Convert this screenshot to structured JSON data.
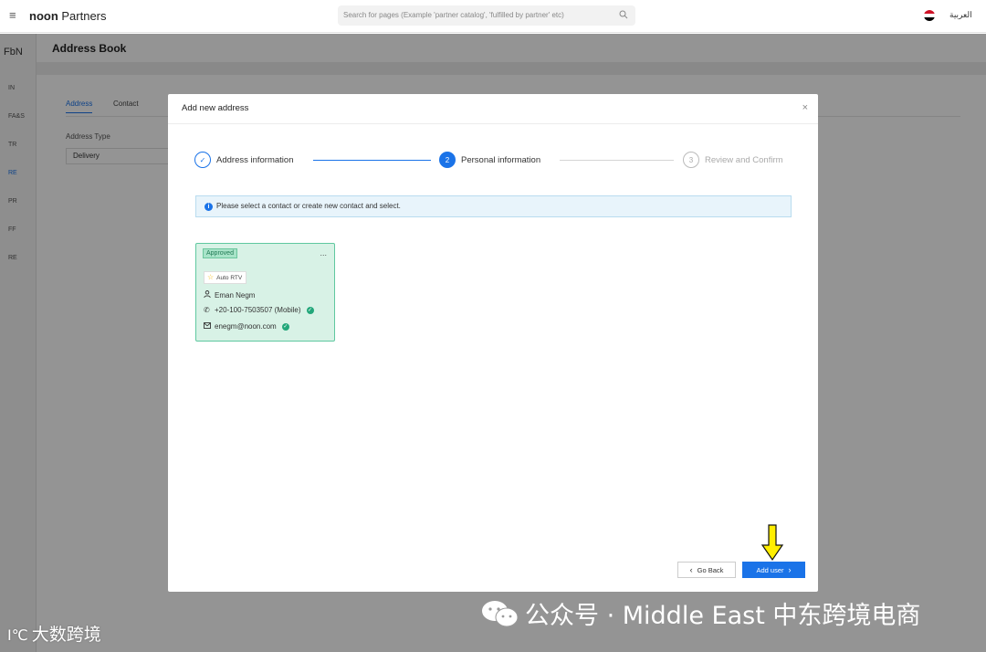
{
  "topbar": {
    "brand_bold": "noon",
    "brand_rest": " Partners",
    "search_placeholder": "Search for pages (Example 'partner catalog', 'fulfilled by partner' etc)",
    "language": "العربية"
  },
  "leftnav": {
    "title": "FbN",
    "items": [
      "IN",
      "FA&S",
      "TR",
      "RE",
      "PR",
      "FF",
      "RE"
    ]
  },
  "page": {
    "title": "Address Book",
    "tabs": [
      "Address",
      "Contact"
    ],
    "address_type_label": "Address Type",
    "address_type_value": "Delivery"
  },
  "modal": {
    "title": "Add new address",
    "close": "×",
    "steps": [
      {
        "number": "✓",
        "label": "Address information"
      },
      {
        "number": "2",
        "label": "Personal information"
      },
      {
        "number": "3",
        "label": "Review and Confirm"
      }
    ],
    "info": "Please select a contact or create new contact and select.",
    "contact": {
      "status": "Approved",
      "more": "...",
      "tag": "Auto RTV",
      "name": "Eman Negm",
      "phone": "+20-100-7503507 (Mobile)",
      "email": "enegm@noon.com"
    },
    "back_label": "Go Back",
    "add_label": "Add user"
  },
  "watermarks": {
    "left": "大数跨境",
    "left_logo": "I℃",
    "right": "公众号 · Middle East 中东跨境电商"
  },
  "colors": {
    "accent": "#1a73e8",
    "approved_bg": "#d8f2e6",
    "annotation_arrow": "#ffee00"
  }
}
